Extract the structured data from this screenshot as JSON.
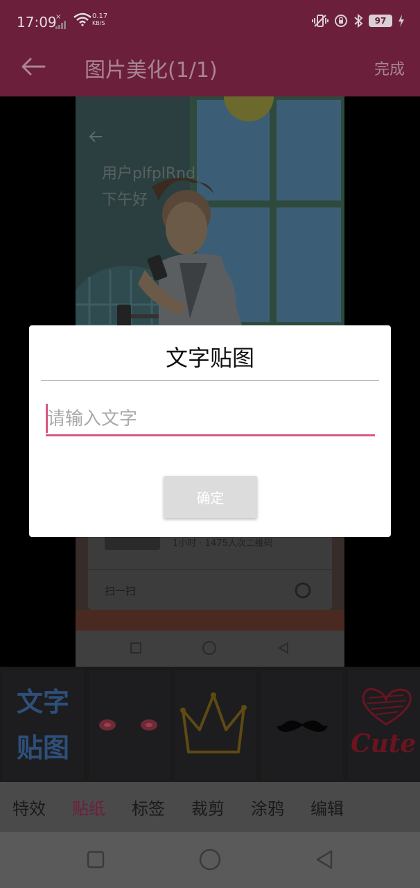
{
  "status": {
    "time": "17:09",
    "net": "×",
    "speed_value": "0.17",
    "speed_unit": "KB/S",
    "battery": "97"
  },
  "header": {
    "title": "图片美化(1/1)",
    "done": "完成"
  },
  "photo": {
    "greeting_line1": "用户plfplRnd,",
    "greeting_line2": "下午好",
    "bottom_text": "扫一扫",
    "info_text": "1小时 · 1475人次二维码"
  },
  "dialog": {
    "title": "文字贴图",
    "placeholder": "请输入文字",
    "value": "",
    "confirm": "确定"
  },
  "stickers": {
    "text_sticker_line1": "文字",
    "text_sticker_line2": "贴图",
    "cute_label": "Cute"
  },
  "tabs": [
    {
      "label": "特效"
    },
    {
      "label": "贴纸"
    },
    {
      "label": "标签"
    },
    {
      "label": "裁剪"
    },
    {
      "label": "涂鸦"
    },
    {
      "label": "编辑"
    }
  ],
  "colors": {
    "header": "#6b1f3b",
    "accent": "#d9587d",
    "active_tab": "#6d1f3e"
  }
}
